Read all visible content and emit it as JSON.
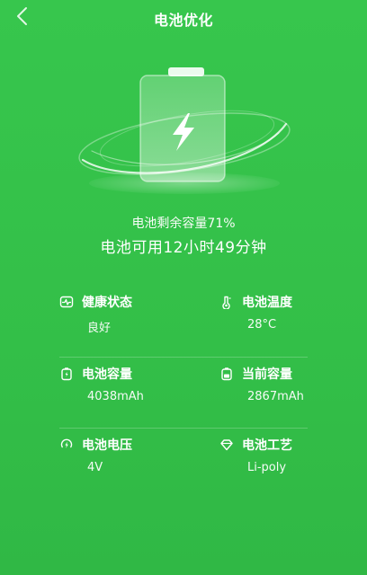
{
  "header": {
    "title": "电池优化",
    "back_icon": "chevron-left-icon"
  },
  "battery": {
    "icon": "lightning-bolt-icon",
    "level_percent": 71
  },
  "summary": {
    "remaining_text": "电池剩余容量71%",
    "usable_text": "电池可用12小时49分钟"
  },
  "details": {
    "health": {
      "icon": "heartbeat-icon",
      "label": "健康状态",
      "value": "良好"
    },
    "temperature": {
      "icon": "thermometer-icon",
      "label": "电池温度",
      "value": "28°C"
    },
    "capacity": {
      "icon": "battery-capacity-icon",
      "label": "电池容量",
      "value": "4038mAh"
    },
    "current_capacity": {
      "icon": "battery-current-icon",
      "label": "当前容量",
      "value": "2867mAh"
    },
    "voltage": {
      "icon": "voltage-icon",
      "label": "电池电压",
      "value": "4V"
    },
    "technology": {
      "icon": "diamond-icon",
      "label": "电池工艺",
      "value": "Li-poly"
    }
  },
  "colors": {
    "background": "#34c24a",
    "foreground": "#ffffff"
  }
}
